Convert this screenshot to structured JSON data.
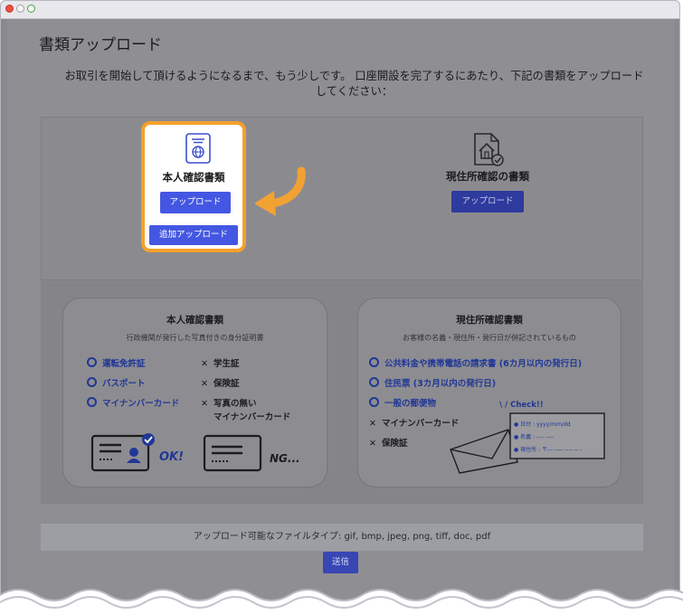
{
  "page": {
    "title": "書類アップロード",
    "intro_line1": "お取引を開始して頂けるようになるまで、もう少しです。 口座開設を完了するにあたり、下記の書類をアップロード",
    "intro_line2": "してください："
  },
  "id_card": {
    "title": "本人確認書類",
    "upload_label": "アップロード",
    "add_upload_label": "追加アップロード",
    "icon": "passport-icon"
  },
  "address_card": {
    "title": "現住所確認の書類",
    "upload_label": "アップロード",
    "icon": "house-document-icon"
  },
  "id_info": {
    "title": "本人確認書類",
    "subtitle": "行政機関が発行した写真付きの身分証明書",
    "ok_items": [
      "運転免許証",
      "パスポート",
      "マイナンバーカード"
    ],
    "ng_items": [
      "学生証",
      "保険証",
      "写真の無い"
    ],
    "ng_item3_line2": "マイナンバーカード",
    "ok_mark": "OK!",
    "ng_mark": "NG..."
  },
  "address_info": {
    "title": "現住所確認書類",
    "subtitle": "お客様の名義・現住所・発行日が併記されているもの",
    "ok_items": [
      "公共料金や携帯電話の請求書 (6カ月以内の発行日)",
      "住民票 (3カ月以内の発行日)",
      "一般の郵便物"
    ],
    "ng_items": [
      "マイナンバーカード",
      "保険証"
    ],
    "check_title": "Check!!",
    "check_fields": [
      "日付",
      "名義",
      "現住所"
    ],
    "check_values": [
      ": yyyy/mm/dd",
      ": ---- ----",
      ": 〒--- ---- ---- -- -"
    ]
  },
  "footer": {
    "file_types": "アップロード可能なファイルタイプ: gif, bmp, jpeg, png, tiff, doc, pdf",
    "submit_label": "送信"
  },
  "colors": {
    "accent": "#4457e2",
    "highlight_border": "#f5a02a",
    "ok_blue": "#213796"
  }
}
